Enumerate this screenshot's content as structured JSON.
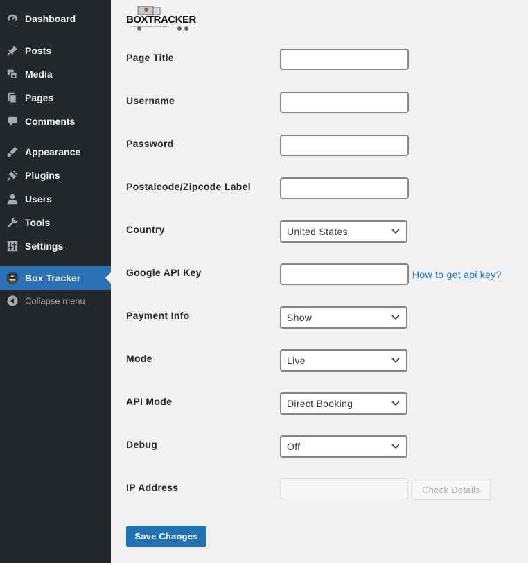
{
  "sidebar": {
    "items": [
      {
        "label": "Dashboard",
        "icon": "dashboard-icon"
      },
      {
        "label": "Posts",
        "icon": "pin-icon"
      },
      {
        "label": "Media",
        "icon": "media-icon"
      },
      {
        "label": "Pages",
        "icon": "pages-icon"
      },
      {
        "label": "Comments",
        "icon": "comment-icon"
      },
      {
        "label": "Appearance",
        "icon": "brush-icon"
      },
      {
        "label": "Plugins",
        "icon": "plugin-icon"
      },
      {
        "label": "Users",
        "icon": "user-icon"
      },
      {
        "label": "Tools",
        "icon": "wrench-icon"
      },
      {
        "label": "Settings",
        "icon": "settings-icon"
      },
      {
        "label": "Box Tracker",
        "icon": "box-tracker-avatar-icon",
        "active": true
      }
    ],
    "collapse_label": "Collapse menu"
  },
  "logo": {
    "text": "BOXTRACKER",
    "tagline": "A GLOBAL APP SOLUTIONS PRODUCT"
  },
  "form": {
    "page_title": {
      "label": "Page Title",
      "value": ""
    },
    "username": {
      "label": "Username",
      "value": ""
    },
    "password": {
      "label": "Password",
      "value": ""
    },
    "postal_label": {
      "label": "Postalcode/Zipcode Label",
      "value": ""
    },
    "country": {
      "label": "Country",
      "value": "United States"
    },
    "google_api": {
      "label": "Google API Key",
      "value": "",
      "help_link": "How to get api key?"
    },
    "payment_info": {
      "label": "Payment Info",
      "value": "Show"
    },
    "mode": {
      "label": "Mode",
      "value": "Live"
    },
    "api_mode": {
      "label": "API Mode",
      "value": "Direct Booking"
    },
    "debug": {
      "label": "Debug",
      "value": "Off"
    },
    "ip_address": {
      "label": "IP Address",
      "value": "",
      "check_label": "Check Details"
    },
    "save_label": "Save Changes"
  },
  "colors": {
    "sidebar_bg": "#23282d",
    "active_bg": "#2a72b5",
    "primary_button": "#2271b1",
    "page_bg": "#f1f1f1"
  }
}
